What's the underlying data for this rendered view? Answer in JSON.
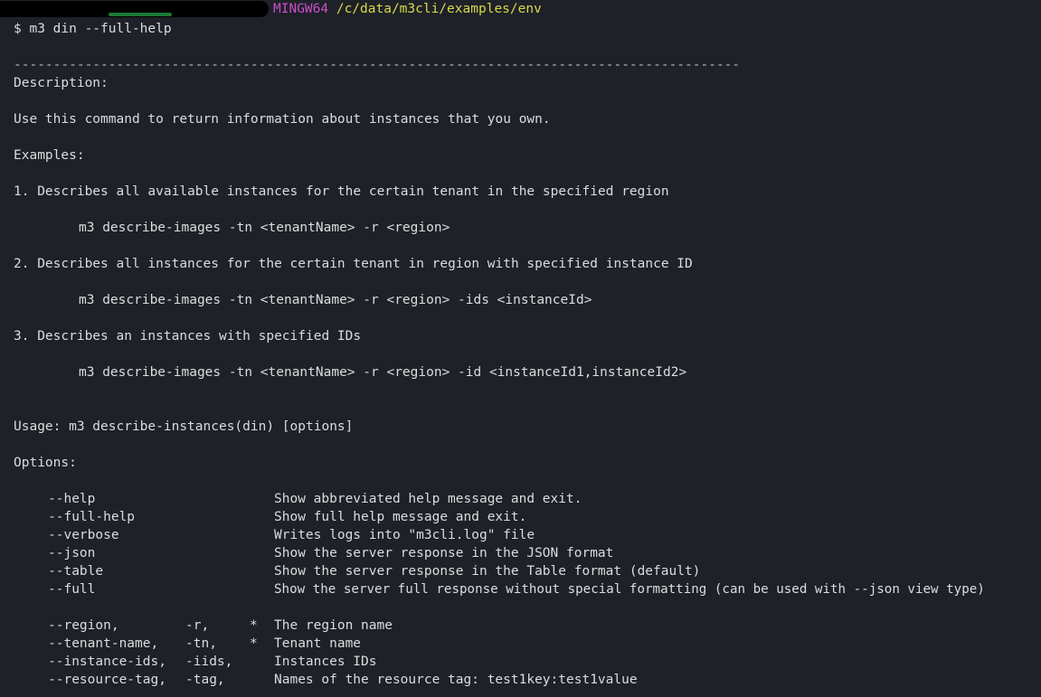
{
  "prompt": {
    "env": "MINGW64",
    "path": "/c/data/m3cli/examples/env",
    "command": "$ m3 din --full-help"
  },
  "separator": "--------------------------------------------------------------------------------------------",
  "description_header": "Description:",
  "description_text": "Use this command to return information about instances that you own.",
  "examples_header": "Examples:",
  "examples": [
    {
      "title": "1. Describes all available instances for the certain tenant in the specified region",
      "command": "m3 describe-images -tn <tenantName> -r <region>"
    },
    {
      "title": "2. Describes all instances for the certain tenant in region with specified instance ID",
      "command": "m3 describe-images -tn <tenantName> -r <region> -ids <instanceId>"
    },
    {
      "title": "3. Describes an instances with specified IDs",
      "command": "m3 describe-images -tn <tenantName> -r <region> -id <instanceId1,instanceId2>"
    }
  ],
  "usage": "Usage: m3 describe-instances(din) [options]",
  "options_header": "Options:",
  "general_options": [
    {
      "flag": "--help",
      "desc": "Show abbreviated help message and exit."
    },
    {
      "flag": "--full-help",
      "desc": "Show full help message and exit."
    },
    {
      "flag": "--verbose",
      "desc": "Writes logs into \"m3cli.log\" file"
    },
    {
      "flag": "--json",
      "desc": "Show the server response in the JSON format"
    },
    {
      "flag": "--table",
      "desc": "Show the server response in the Table format (default)"
    },
    {
      "flag": "--full",
      "desc": "Show the server full response without special formatting (can be used with --json view type)"
    }
  ],
  "param_options": [
    {
      "flag": "--region,",
      "short": "-r,",
      "required": "*",
      "desc": "The region name"
    },
    {
      "flag": "--tenant-name,",
      "short": "-tn,",
      "required": "*",
      "desc": "Tenant name"
    },
    {
      "flag": "--instance-ids,",
      "short": "-iids,",
      "required": "",
      "desc": "Instances IDs"
    },
    {
      "flag": "--resource-tag,",
      "short": "-tag,",
      "required": "",
      "desc": "Names of the resource tag: test1key:test1value"
    }
  ]
}
